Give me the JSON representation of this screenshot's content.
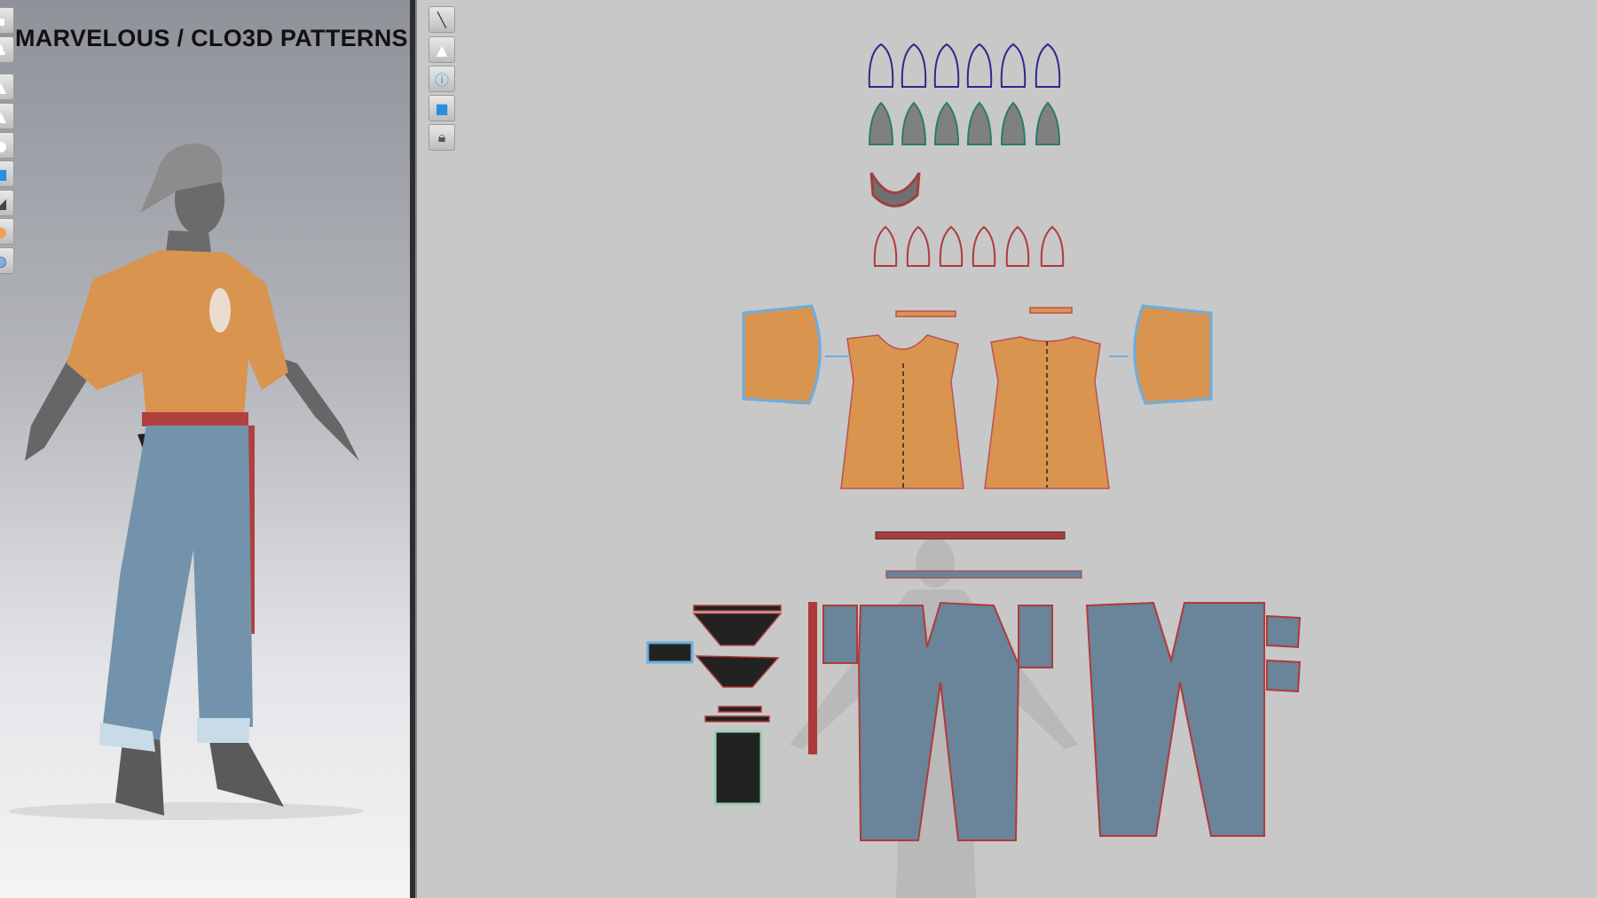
{
  "header": {
    "title": "MARVELOUS / CLO3D PATTERNS"
  },
  "left_toolbar": {
    "icons": [
      "box-icon",
      "shirt-avatar-icon",
      "shirt-icon",
      "sewing-shirt-icon",
      "avatar-icon",
      "fabric-icon",
      "texture-icon",
      "avatar-skin-icon",
      "globe-icon"
    ]
  },
  "right_toolbar": {
    "icons": [
      "show-seam-icon",
      "show-garment-icon",
      "info-icon",
      "show-fabric-icon",
      "lock-garment-icon"
    ]
  },
  "colors": {
    "tshirt": "#d99450",
    "denim": "#6a8499",
    "seam_red": "#b03a3a",
    "cap_outline": "#2b2a8c",
    "cap_fill": "#808080",
    "bag": "#222222",
    "selection": "#6aaee0"
  }
}
